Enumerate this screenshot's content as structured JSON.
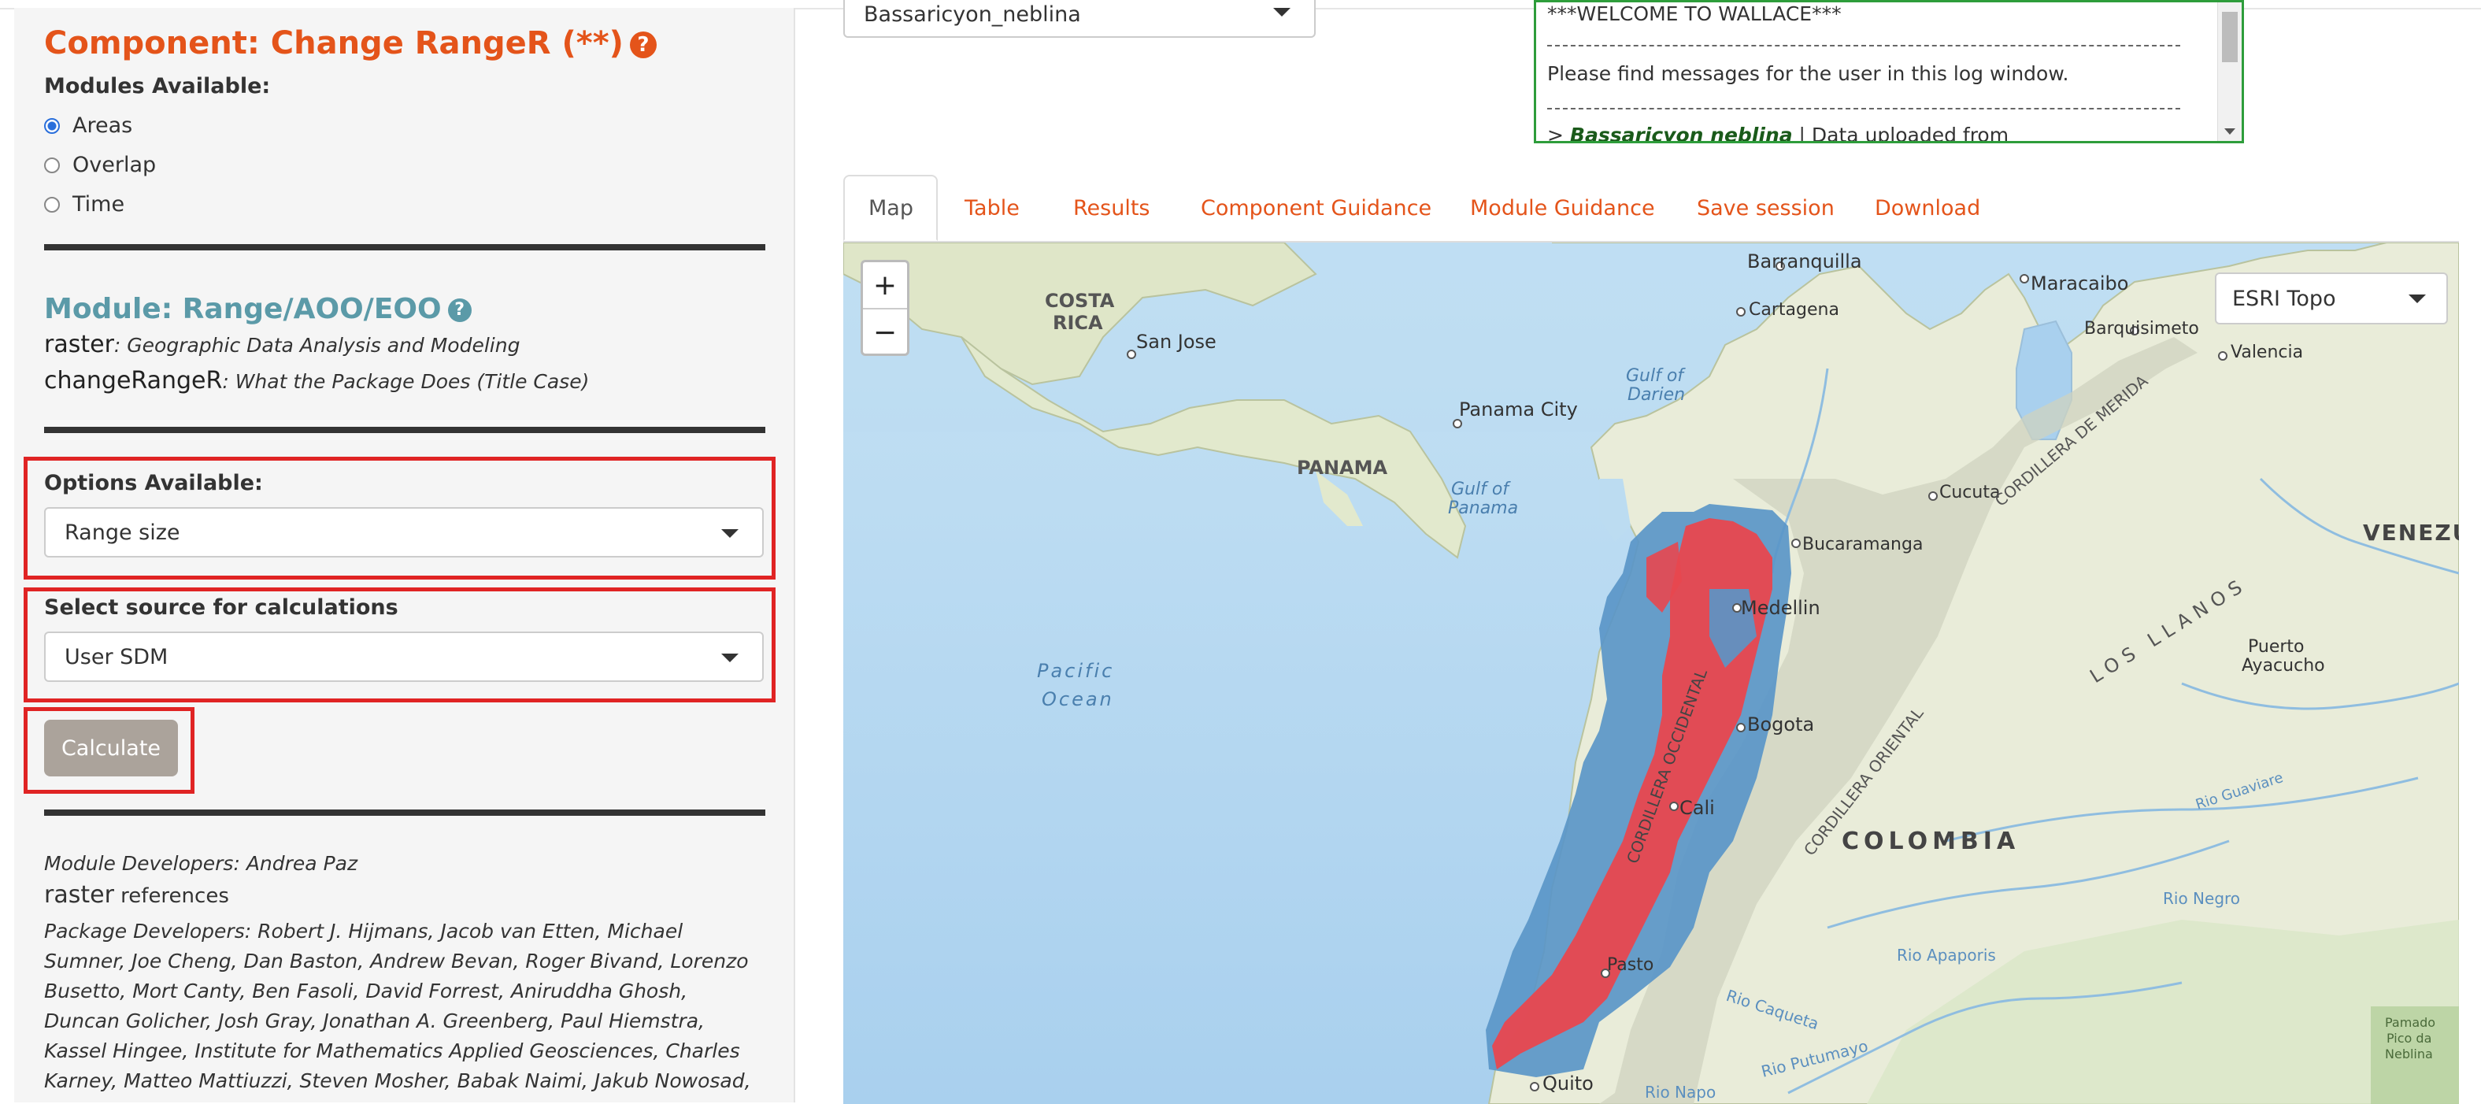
{
  "component": {
    "title": "Component: Change RangeR (**)",
    "help": "?"
  },
  "modules_available": {
    "label": "Modules Available:",
    "options": [
      "Areas",
      "Overlap",
      "Time"
    ],
    "selected": "Areas"
  },
  "module": {
    "title": "Module: Range/AOO/EOO",
    "help": "?",
    "packages": [
      {
        "name": "raster",
        "desc": ": Geographic Data Analysis and Modeling"
      },
      {
        "name": "changeRangeR",
        "desc": ": What the Package Does (Title Case)"
      }
    ]
  },
  "options_available": {
    "label": "Options Available:",
    "value": "Range size"
  },
  "source": {
    "label": "Select source for calculations",
    "value": "User SDM"
  },
  "calculate_label": "Calculate",
  "developers": {
    "module_devs": "Module Developers: Andrea Paz",
    "ref_pkg": "raster",
    "ref_word": " references",
    "package_devs": "Package Developers: Robert J. Hijmans, Jacob van Etten, Michael Sumner, Joe Cheng, Dan Baston, Andrew Bevan, Roger Bivand, Lorenzo Busetto, Mort Canty, Ben Fasoli, David Forrest, Aniruddha Ghosh, Duncan Golicher, Josh Gray, Jonathan A. Greenberg, Paul Hiemstra, Kassel Hingee, Institute for Mathematics Applied Geosciences, Charles Karney, Matteo Mattiuzzi, Steven Mosher, Babak Naimi, Jakub Nowosad, Edzer Pebesma, Oscar"
  },
  "species_select": {
    "value": "Bassaricyon_neblina"
  },
  "log": {
    "welcome": "***WELCOME TO WALLACE***",
    "message": "Please find messages for the user in this log window.",
    "entry_prefix": "> ",
    "entry_species": "Bassaricyon neblina",
    "entry_text": " | Data uploaded from"
  },
  "tabs": [
    "Map",
    "Table",
    "Results",
    "Component Guidance",
    "Module Guidance",
    "Save session",
    "Download"
  ],
  "active_tab": "Map",
  "map": {
    "zoom_in": "+",
    "zoom_out": "−",
    "basemap": "ESRI Topo",
    "labels": {
      "barranquilla": "Barranquilla",
      "maracaibo": "Maracaibo",
      "costa_rica_1": "COSTA",
      "costa_rica_2": "RICA",
      "cartagena": "Cartagena",
      "barquisimeto": "Barquisimeto",
      "valencia": "Valencia",
      "san_jose": "San Jose",
      "gulf_darien_1": "Gulf of",
      "gulf_darien_2": "Darien",
      "panama_city": "Panama City",
      "panama": "PANAMA",
      "gulf_panama_1": "Gulf of",
      "gulf_panama_2": "Panama",
      "cucuta": "Cucuta",
      "bucaramanga": "Bucaramanga",
      "venezuela": "VENEZU",
      "llanos": "LOS LLANOS",
      "medellin": "Medellin",
      "pacific_1": "Pacific",
      "pacific_2": "Ocean",
      "bogota": "Bogota",
      "puerto_1": "Puerto",
      "puerto_2": "Ayacucho",
      "cali": "Cali",
      "colombia": "COLOMBIA",
      "rio_guaviare": "Rio Guaviare",
      "rio_negro": "Rio Negro",
      "pasto": "Pasto",
      "quito": "Quito",
      "rio_apaporis": "Rio Apaporis",
      "rio_caqueta": "Rio Caqueta",
      "rio_putumayo": "Rio Putumayo",
      "rio_napo": "Rio Napo",
      "cord_merida": "CORDILLERA DE MERIDA",
      "cord_oriental": "CORDILLERA ORIENTAL",
      "cord_occidental": "CORDILLERA OCCIDENTAL",
      "pico_neblina_1": "Pamado",
      "pico_neblina_2": "Pico da",
      "pico_neblina_3": "Neblina"
    }
  },
  "colors": {
    "accent_orange": "#e4541a",
    "module_teal": "#5b9aa8",
    "highlight_red": "#e02424",
    "log_border": "#2e9d3b",
    "range_blue": "#5a96c8",
    "range_red": "#e8474f",
    "ocean": "#b4d6ef",
    "land": "#e9ecd9"
  }
}
